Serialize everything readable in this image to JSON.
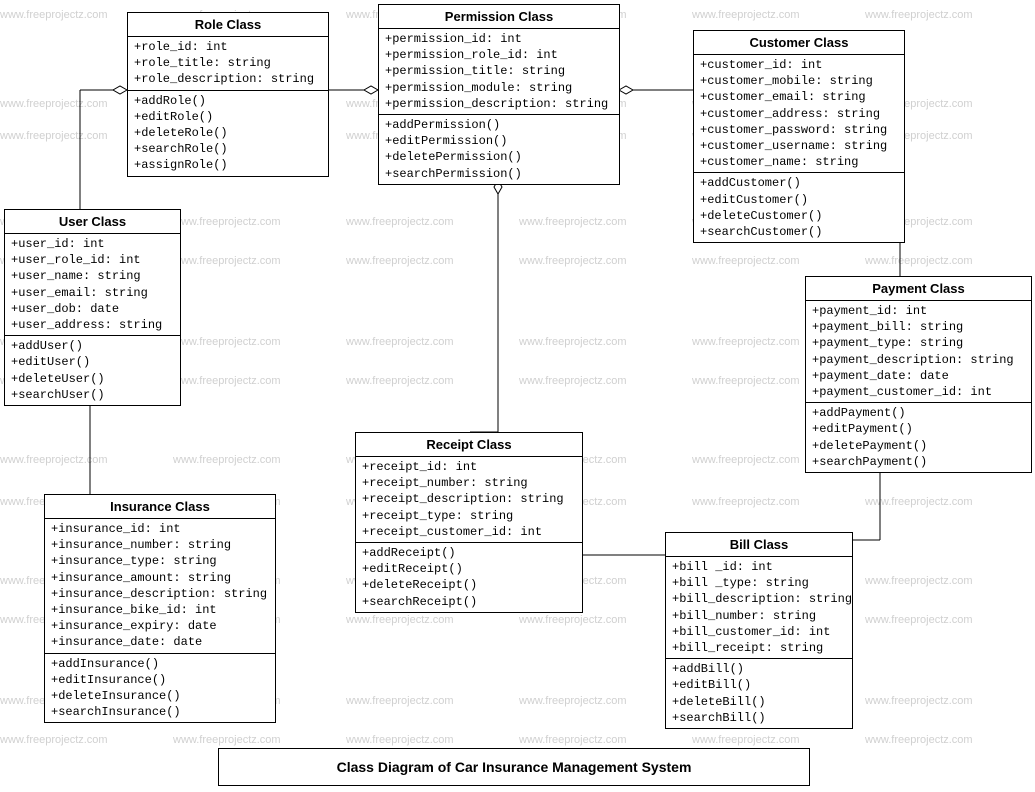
{
  "diagram_title": "Class Diagram of Car Insurance Management System",
  "watermark_text": "www.freeprojectz.com",
  "classes": {
    "role": {
      "name": "Role Class",
      "attrs": [
        "+role_id: int",
        "+role_title: string",
        "+role_description: string"
      ],
      "methods": [
        "+addRole()",
        "+editRole()",
        "+deleteRole()",
        "+searchRole()",
        "+assignRole()"
      ]
    },
    "permission": {
      "name": "Permission Class",
      "attrs": [
        "+permission_id: int",
        "+permission_role_id: int",
        "+permission_title: string",
        "+permission_module: string",
        "+permission_description: string"
      ],
      "methods": [
        "+addPermission()",
        "+editPermission()",
        "+deletePermission()",
        "+searchPermission()"
      ]
    },
    "customer": {
      "name": "Customer Class",
      "attrs": [
        "+customer_id: int",
        "+customer_mobile: string",
        "+customer_email: string",
        "+customer_address: string",
        "+customer_password: string",
        "+customer_username: string",
        "+customer_name: string"
      ],
      "methods": [
        "+addCustomer()",
        "+editCustomer()",
        "+deleteCustomer()",
        "+searchCustomer()"
      ]
    },
    "user": {
      "name": "User Class",
      "attrs": [
        "+user_id: int",
        "+user_role_id: int",
        "+user_name: string",
        "+user_email: string",
        "+user_dob: date",
        "+user_address: string"
      ],
      "methods": [
        "+addUser()",
        "+editUser()",
        "+deleteUser()",
        "+searchUser()"
      ]
    },
    "payment": {
      "name": "Payment Class",
      "attrs": [
        "+payment_id: int",
        "+payment_bill: string",
        "+payment_type: string",
        "+payment_description: string",
        "+payment_date: date",
        "+payment_customer_id: int"
      ],
      "methods": [
        "+addPayment()",
        "+editPayment()",
        "+deletePayment()",
        "+searchPayment()"
      ]
    },
    "receipt": {
      "name": "Receipt Class",
      "attrs": [
        "+receipt_id: int",
        "+receipt_number: string",
        "+receipt_description: string",
        "+receipt_type: string",
        "+receipt_customer_id: int"
      ],
      "methods": [
        "+addReceipt()",
        "+editReceipt()",
        "+deleteReceipt()",
        "+searchReceipt()"
      ]
    },
    "insurance": {
      "name": "Insurance Class",
      "attrs": [
        "+insurance_id: int",
        "+insurance_number: string",
        "+insurance_type: string",
        "+insurance_amount: string",
        "+insurance_description: string",
        "+insurance_bike_id:  int",
        "+insurance_expiry: date",
        "+insurance_date: date"
      ],
      "methods": [
        "+addInsurance()",
        "+editInsurance()",
        "+deleteInsurance()",
        "+searchInsurance()"
      ]
    },
    "bill": {
      "name": "Bill Class",
      "attrs": [
        "+bill _id: int",
        "+bill _type: string",
        "+bill_description: string",
        "+bill_number: string",
        "+bill_customer_id: int",
        "+bill_receipt: string"
      ],
      "methods": [
        "+addBill()",
        "+editBill()",
        "+deleteBill()",
        "+searchBill()"
      ]
    }
  }
}
